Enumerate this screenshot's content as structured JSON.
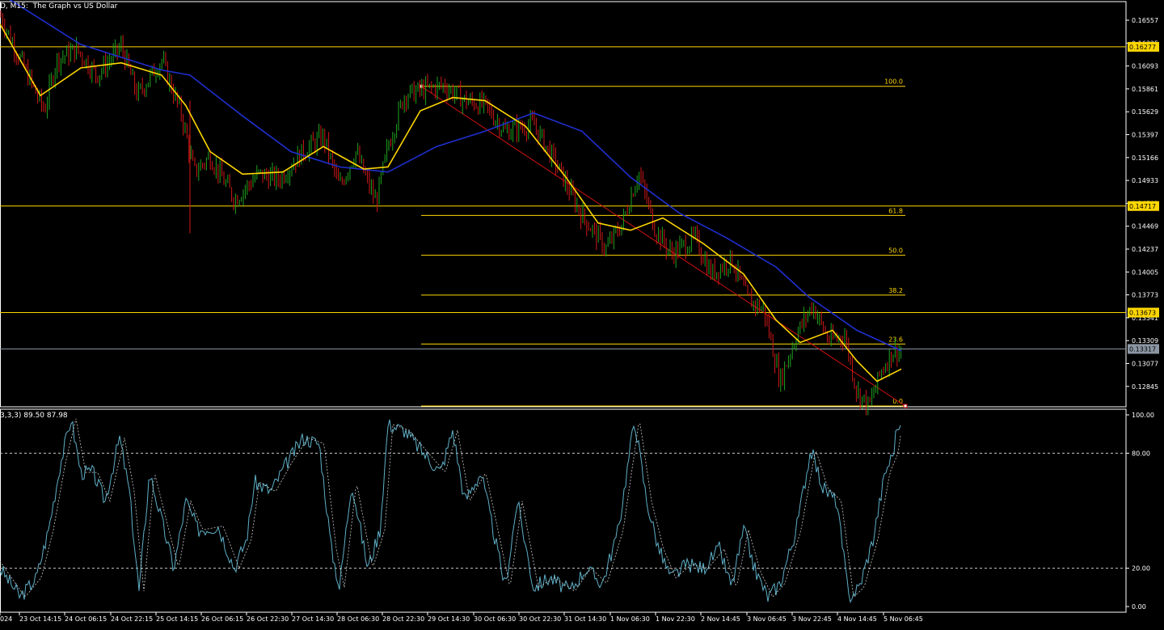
{
  "window": {
    "title": "D, M15:  The Graph vs US Dollar",
    "indicator_header": "3,3,3) 89.50 87.98"
  },
  "colors": {
    "background": "#000000",
    "frame": "#ffffff",
    "bull_candle": "#1fa31f",
    "bear_candle": "#d01818",
    "ma_fast": "#ffd700",
    "ma_slow": "#1f2fd0",
    "horizontal_line": "#ffd700",
    "current_price_line": "#8a96a3",
    "fib": "#ffd700",
    "trend_line": "#cc1010",
    "oscillator": "#5fb0c8"
  },
  "price_axis": {
    "ticks": [
      "0.16557",
      "0.16325",
      "0.16093",
      "0.15861",
      "0.15629",
      "0.15397",
      "0.15166",
      "0.14933",
      "0.14701",
      "0.14469",
      "0.14237",
      "0.14005",
      "0.13773",
      "0.13541",
      "0.13309",
      "0.13077",
      "0.12845"
    ]
  },
  "price_labels": {
    "line1": "0.16277",
    "line2": "0.14717",
    "line3": "0.13673",
    "current": "0.13317"
  },
  "fib": {
    "levels": [
      "100.0",
      "61.8",
      "50.0",
      "38.2",
      "23.6",
      "0.0"
    ]
  },
  "oscillator_axis": {
    "ticks": [
      "100.00",
      "80.00",
      "20.00",
      "0.00"
    ]
  },
  "time_axis": {
    "labels": [
      "024",
      "23 Oct 14:15",
      "24 Oct 06:15",
      "24 Oct 22:15",
      "25 Oct 14:15",
      "26 Oct 06:15",
      "26 Oct 22:30",
      "27 Oct 14:30",
      "28 Oct 06:30",
      "28 Oct 22:30",
      "29 Oct 14:30",
      "30 Oct 06:30",
      "30 Oct 22:30",
      "31 Oct 14:30",
      "1 Nov 06:30",
      "1 Nov 22:30",
      "2 Nov 14:45",
      "3 Nov 06:45",
      "3 Nov 22:45",
      "4 Nov 14:45",
      "5 Nov 06:45"
    ]
  },
  "chart_data": {
    "type": "line",
    "title": "",
    "xlabel": "",
    "ylabel": "",
    "ylim": [
      0.1275,
      0.1672
    ],
    "price_path": [
      [
        0,
        0.1659
      ],
      [
        40,
        0.159
      ],
      [
        55,
        0.1565
      ],
      [
        70,
        0.1615
      ],
      [
        95,
        0.1625
      ],
      [
        120,
        0.16
      ],
      [
        150,
        0.1628
      ],
      [
        170,
        0.158
      ],
      [
        200,
        0.1615
      ],
      [
        225,
        0.156
      ],
      [
        240,
        0.1505
      ],
      [
        260,
        0.152
      ],
      [
        290,
        0.1478
      ],
      [
        320,
        0.1503
      ],
      [
        345,
        0.1498
      ],
      [
        375,
        0.1525
      ],
      [
        400,
        0.154
      ],
      [
        420,
        0.149
      ],
      [
        440,
        0.1525
      ],
      [
        465,
        0.1475
      ],
      [
        480,
        0.153
      ],
      [
        500,
        0.158
      ],
      [
        520,
        0.1585
      ],
      [
        550,
        0.159
      ],
      [
        575,
        0.1575
      ],
      [
        600,
        0.157
      ],
      [
        625,
        0.1545
      ],
      [
        660,
        0.1552
      ],
      [
        690,
        0.151
      ],
      [
        720,
        0.1462
      ],
      [
        750,
        0.143
      ],
      [
        770,
        0.1455
      ],
      [
        790,
        0.1505
      ],
      [
        810,
        0.145
      ],
      [
        830,
        0.1425
      ],
      [
        860,
        0.144
      ],
      [
        880,
        0.1405
      ],
      [
        905,
        0.142
      ],
      [
        925,
        0.138
      ],
      [
        945,
        0.137
      ],
      [
        965,
        0.13
      ],
      [
        985,
        0.1345
      ],
      [
        1005,
        0.1375
      ],
      [
        1025,
        0.134
      ],
      [
        1045,
        0.1345
      ],
      [
        1060,
        0.129
      ],
      [
        1075,
        0.1275
      ],
      [
        1090,
        0.131
      ],
      [
        1105,
        0.133
      ],
      [
        1115,
        0.133
      ]
    ],
    "ma_fast": [
      [
        0,
        0.165
      ],
      [
        50,
        0.158
      ],
      [
        100,
        0.1607
      ],
      [
        150,
        0.1612
      ],
      [
        200,
        0.16
      ],
      [
        230,
        0.157
      ],
      [
        260,
        0.1525
      ],
      [
        300,
        0.1503
      ],
      [
        350,
        0.1505
      ],
      [
        400,
        0.153
      ],
      [
        450,
        0.1508
      ],
      [
        480,
        0.151
      ],
      [
        520,
        0.1565
      ],
      [
        560,
        0.1578
      ],
      [
        600,
        0.1575
      ],
      [
        650,
        0.155
      ],
      [
        700,
        0.15
      ],
      [
        740,
        0.1455
      ],
      [
        780,
        0.1448
      ],
      [
        820,
        0.146
      ],
      [
        870,
        0.1435
      ],
      [
        920,
        0.1405
      ],
      [
        960,
        0.136
      ],
      [
        990,
        0.1338
      ],
      [
        1030,
        0.135
      ],
      [
        1060,
        0.132
      ],
      [
        1085,
        0.13
      ],
      [
        1115,
        0.1312
      ]
    ],
    "ma_slow": [
      [
        0,
        0.168
      ],
      [
        100,
        0.163
      ],
      [
        200,
        0.1605
      ],
      [
        235,
        0.16
      ],
      [
        300,
        0.156
      ],
      [
        360,
        0.1525
      ],
      [
        420,
        0.151
      ],
      [
        480,
        0.1505
      ],
      [
        540,
        0.153
      ],
      [
        600,
        0.1545
      ],
      [
        660,
        0.1563
      ],
      [
        720,
        0.1545
      ],
      [
        780,
        0.15
      ],
      [
        840,
        0.1465
      ],
      [
        900,
        0.144
      ],
      [
        960,
        0.1412
      ],
      [
        1000,
        0.1383
      ],
      [
        1060,
        0.135
      ],
      [
        1115,
        0.133
      ]
    ],
    "horizontal_lines": [
      0.16277,
      0.14717,
      0.13673
    ],
    "current_price": 0.13317,
    "fib_levels": [
      {
        "label": "100.0",
        "price": 0.1589
      },
      {
        "label": "61.8",
        "price": 0.14625
      },
      {
        "label": "50.0",
        "price": 0.14235
      },
      {
        "label": "38.2",
        "price": 0.13845
      },
      {
        "label": "23.6",
        "price": 0.13365
      },
      {
        "label": "0.0",
        "price": 0.12585
      }
    ],
    "trend_line": [
      [
        0.1589
      ],
      [
        0.12585
      ]
    ],
    "oscillator": {
      "ylim": [
        0,
        100
      ],
      "levels": [
        80,
        20
      ],
      "header_values": [
        89.5,
        87.98
      ],
      "path": [
        [
          0,
          20
        ],
        [
          25,
          5
        ],
        [
          45,
          15
        ],
        [
          60,
          40
        ],
        [
          75,
          75
        ],
        [
          88,
          98
        ],
        [
          100,
          70
        ],
        [
          115,
          70
        ],
        [
          130,
          55
        ],
        [
          148,
          88
        ],
        [
          160,
          60
        ],
        [
          172,
          8
        ],
        [
          185,
          70
        ],
        [
          200,
          45
        ],
        [
          215,
          20
        ],
        [
          230,
          55
        ],
        [
          245,
          40
        ],
        [
          270,
          42
        ],
        [
          290,
          20
        ],
        [
          305,
          35
        ],
        [
          315,
          65
        ],
        [
          335,
          60
        ],
        [
          355,
          75
        ],
        [
          375,
          88
        ],
        [
          395,
          85
        ],
        [
          410,
          30
        ],
        [
          420,
          10
        ],
        [
          435,
          65
        ],
        [
          455,
          20
        ],
        [
          470,
          40
        ],
        [
          480,
          95
        ],
        [
          500,
          92
        ],
        [
          520,
          82
        ],
        [
          545,
          70
        ],
        [
          560,
          92
        ],
        [
          575,
          55
        ],
        [
          595,
          70
        ],
        [
          610,
          40
        ],
        [
          625,
          10
        ],
        [
          640,
          55
        ],
        [
          660,
          10
        ],
        [
          680,
          15
        ],
        [
          705,
          8
        ],
        [
          725,
          20
        ],
        [
          745,
          12
        ],
        [
          765,
          40
        ],
        [
          785,
          98
        ],
        [
          800,
          55
        ],
        [
          815,
          30
        ],
        [
          830,
          15
        ],
        [
          850,
          22
        ],
        [
          870,
          20
        ],
        [
          890,
          30
        ],
        [
          905,
          10
        ],
        [
          920,
          40
        ],
        [
          935,
          18
        ],
        [
          950,
          5
        ],
        [
          965,
          12
        ],
        [
          985,
          40
        ],
        [
          1003,
          82
        ],
        [
          1018,
          62
        ],
        [
          1035,
          55
        ],
        [
          1050,
          5
        ],
        [
          1063,
          10
        ],
        [
          1080,
          35
        ],
        [
          1095,
          70
        ],
        [
          1105,
          80
        ],
        [
          1110,
          95
        ],
        [
          1115,
          90
        ]
      ]
    }
  }
}
